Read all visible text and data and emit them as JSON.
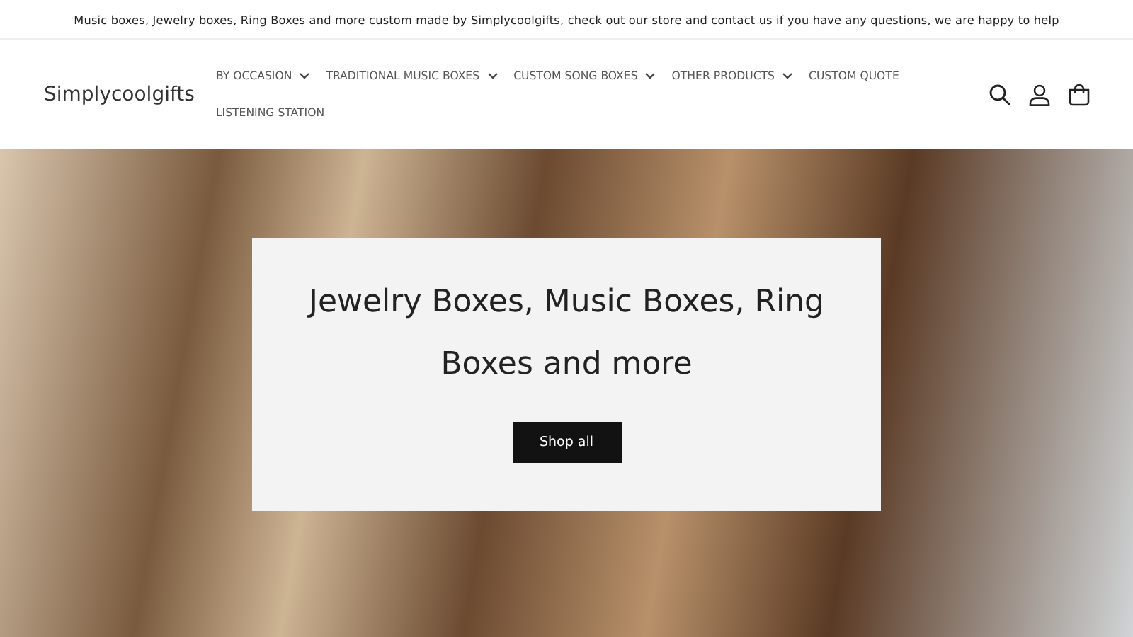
{
  "announcement": "Music boxes, Jewelry boxes, Ring Boxes and more custom made by Simplycoolgifts, check out our store and contact us if you have any questions, we are happy to help",
  "header": {
    "logo": "Simplycoolgifts",
    "nav": [
      {
        "label": "BY OCCASION",
        "dropdown": true
      },
      {
        "label": "TRADITIONAL MUSIC BOXES",
        "dropdown": true
      },
      {
        "label": "CUSTOM SONG BOXES",
        "dropdown": true
      },
      {
        "label": "OTHER PRODUCTS",
        "dropdown": true
      },
      {
        "label": "CUSTOM QUOTE",
        "dropdown": false
      },
      {
        "label": "LISTENING STATION",
        "dropdown": false
      }
    ]
  },
  "hero": {
    "heading": "Jewelry Boxes, Music Boxes, Ring Boxes and more",
    "button": "Shop all"
  }
}
